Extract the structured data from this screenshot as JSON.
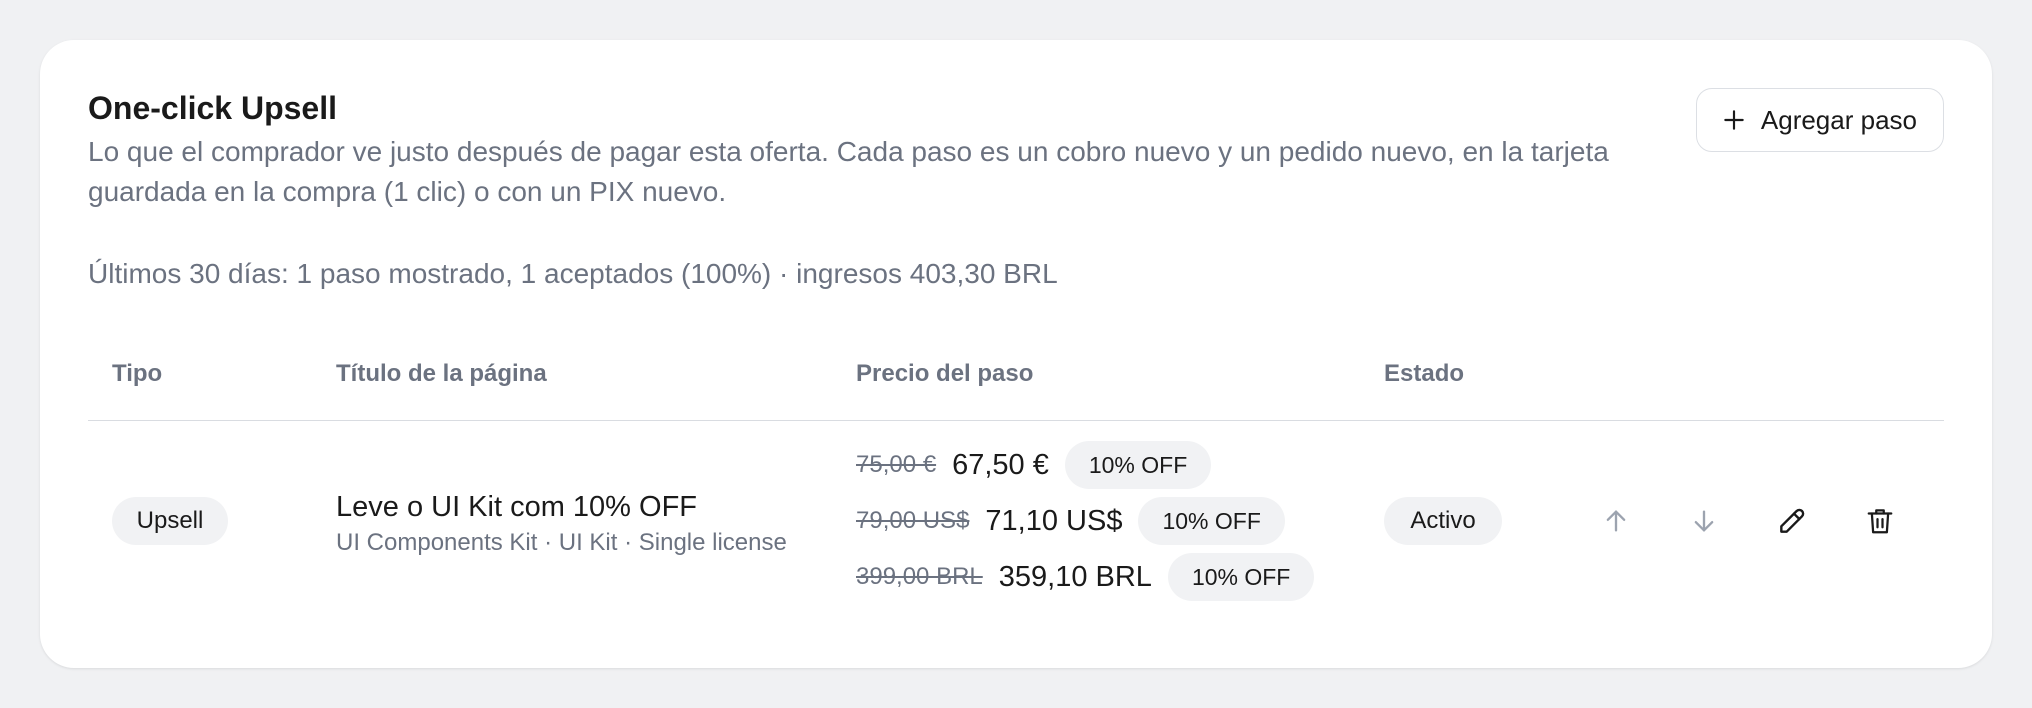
{
  "header": {
    "title": "One-click Upsell",
    "description": "Lo que el comprador ve justo después de pagar esta oferta. Cada paso es un cobro nuevo y un pedido nuevo, en la tarjeta guardada en la compra (1 clic) o con un PIX nuevo.",
    "stats": "Últimos 30 días: 1 paso mostrado, 1 aceptados (100%) · ingresos 403,30 BRL",
    "add_button_label": "Agregar paso",
    "add_button_icon": "plus-icon"
  },
  "table": {
    "columns": [
      "Tipo",
      "Título de la página",
      "Precio del paso",
      "Estado"
    ],
    "rows": [
      {
        "type": "Upsell",
        "page_title": "Leve o UI Kit com 10% OFF",
        "page_subtitle": "UI Components Kit · UI Kit · Single license",
        "prices": [
          {
            "original": "75,00 €",
            "discounted": "67,50 €",
            "badge": "10% OFF"
          },
          {
            "original": "79,00 US$",
            "discounted": "71,10 US$",
            "badge": "10% OFF"
          },
          {
            "original": "399,00 BRL",
            "discounted": "359,10 BRL",
            "badge": "10% OFF"
          }
        ],
        "status": "Activo",
        "actions": [
          "arrow-up-icon",
          "arrow-down-icon",
          "pencil-icon",
          "trash-icon"
        ]
      }
    ]
  },
  "colors": {
    "page_background": "#f0f1f3",
    "card_background": "#ffffff",
    "pill_background": "#f1f2f4",
    "muted_text": "#6b7280",
    "primary_text": "#1a1a1a",
    "disabled_icon": "#9ca3af"
  }
}
